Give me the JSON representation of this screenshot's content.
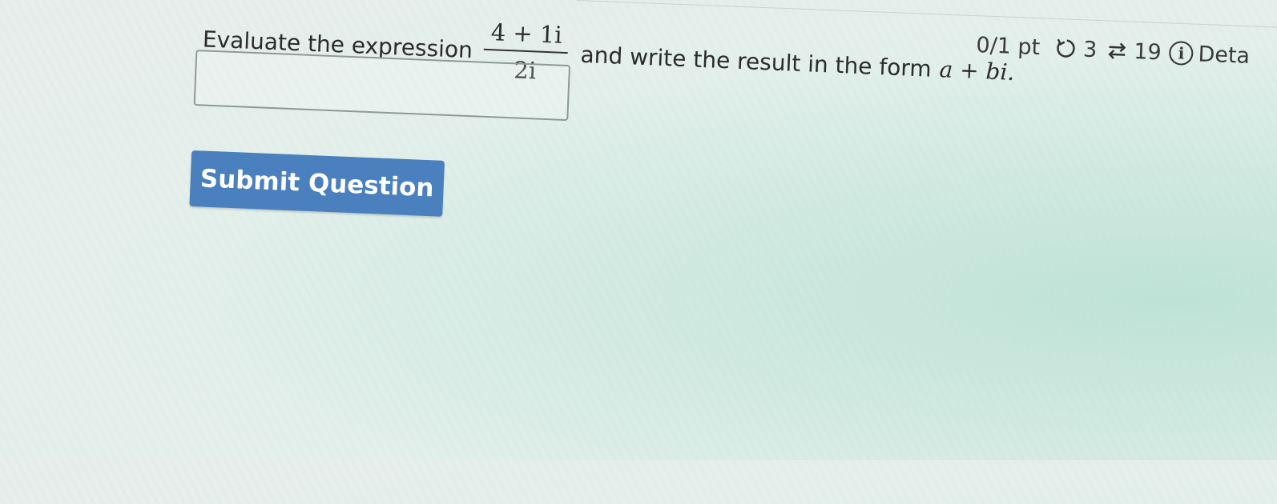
{
  "header": {
    "points_label": "0/1 pt",
    "retry_count": "3",
    "attempts_count": "19",
    "details_label": "Deta"
  },
  "question": {
    "prefix": "Evaluate the expression",
    "numerator": "4 + 1i",
    "denominator": "2i",
    "suffix": "and write the result in the form",
    "form": "a + bi."
  },
  "answer": {
    "value": "",
    "placeholder": ""
  },
  "actions": {
    "submit_label": "Submit Question"
  },
  "icons": {
    "retry": "retry-icon",
    "attempts": "attempts-icon",
    "details": "info-icon"
  },
  "colors": {
    "submit_button": "#4a80be",
    "background": "#e6eeeb"
  }
}
